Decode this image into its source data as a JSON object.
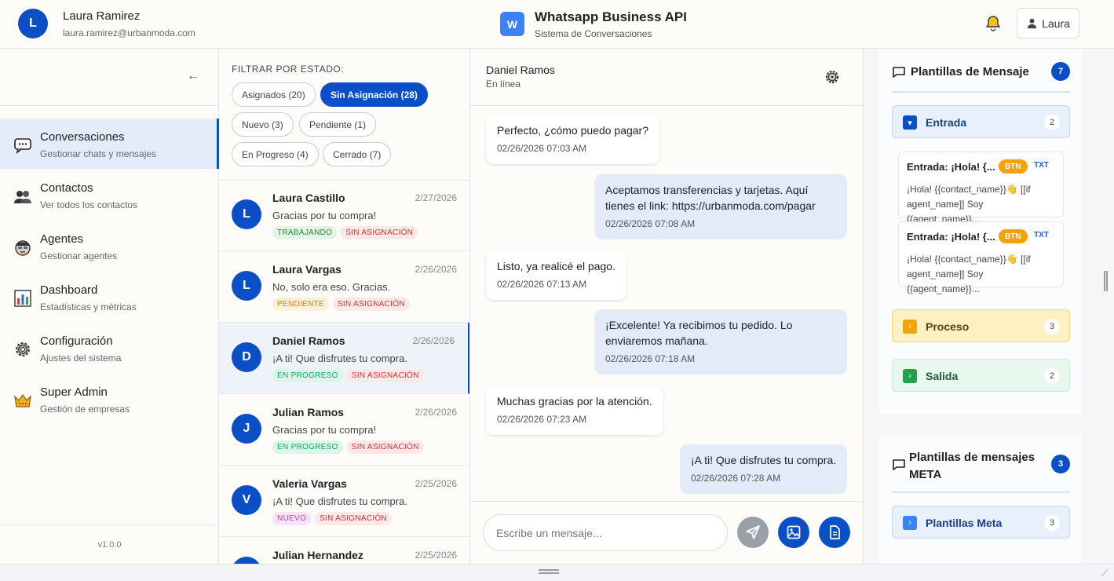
{
  "header": {
    "user_initial": "L",
    "user_name": "Laura Ramirez",
    "user_email": "laura.ramirez@urbanmoda.com",
    "brand_initial": "W",
    "brand_title": "Whatsapp Business API",
    "brand_subtitle": "Sistema de Conversaciones",
    "user_button_label": "Laura"
  },
  "nav": {
    "collapse_glyph": "←",
    "items": [
      {
        "title": "Conversaciones",
        "subtitle": "Gestionar chats y mensajes",
        "icon": "chat-icon"
      },
      {
        "title": "Contactos",
        "subtitle": "Ver todos los contactos",
        "icon": "contacts-icon"
      },
      {
        "title": "Agentes",
        "subtitle": "Gestionar agentes",
        "icon": "agent-icon"
      },
      {
        "title": "Dashboard",
        "subtitle": "Estadísticas y métricas",
        "icon": "chart-icon"
      },
      {
        "title": "Configuración",
        "subtitle": "Ajustes del sistema",
        "icon": "gear-icon"
      },
      {
        "title": "Super Admin",
        "subtitle": "Gestión de empresas",
        "icon": "crown-icon"
      }
    ],
    "version": "v1.0.0"
  },
  "filters": {
    "label": "FILTRAR POR ESTADO:",
    "chips": [
      "Asignados (20)",
      "Sin Asignación (28)",
      "Nuevo (3)",
      "Pendiente (1)",
      "En Progreso (4)",
      "Cerrado (7)"
    ]
  },
  "conversations": [
    {
      "initial": "L",
      "name": "Laura Castillo",
      "date": "2/27/2026",
      "message": "Gracias por tu compra!",
      "status": "TRABAJANDO",
      "assign": "SIN ASIGNACIÓN"
    },
    {
      "initial": "L",
      "name": "Laura Vargas",
      "date": "2/26/2026",
      "message": "No, solo era eso. Gracias.",
      "status": "PENDIENTE",
      "assign": "SIN ASIGNACIÓN"
    },
    {
      "initial": "D",
      "name": "Daniel Ramos",
      "date": "2/26/2026",
      "message": "¡A ti! Que disfrutes tu compra.",
      "status": "EN PROGRESO",
      "assign": "SIN ASIGNACIÓN"
    },
    {
      "initial": "J",
      "name": "Julian Ramos",
      "date": "2/26/2026",
      "message": "Gracias por tu compra!",
      "status": "EN PROGRESO",
      "assign": "SIN ASIGNACIÓN"
    },
    {
      "initial": "V",
      "name": "Valeria Vargas",
      "date": "2/25/2026",
      "message": "¡A ti! Que disfrutes tu compra.",
      "status": "NUEVO",
      "assign": "SIN ASIGNACIÓN"
    },
    {
      "initial": "J",
      "name": "Julian Hernandez",
      "date": "2/25/2026",
      "message": "",
      "status": "",
      "assign": ""
    }
  ],
  "chat": {
    "contact_name": "Daniel Ramos",
    "contact_status": "En línea",
    "messages": [
      {
        "text": "Perfecto, ¿cómo puedo pagar?",
        "time": "02/26/2026 07:03 AM",
        "dir": "in"
      },
      {
        "text": "Aceptamos transferencias y tarjetas. Aquí tienes el link: https://urbanmoda.com/pagar",
        "time": "02/26/2026 07:08 AM",
        "dir": "out"
      },
      {
        "text": "Listo, ya realicé el pago.",
        "time": "02/26/2026 07:13 AM",
        "dir": "in"
      },
      {
        "text": "¡Excelente! Ya recibimos tu pedido. Lo enviaremos mañana.",
        "time": "02/26/2026 07:18 AM",
        "dir": "out"
      },
      {
        "text": "Muchas gracias por la atención.",
        "time": "02/26/2026 07:23 AM",
        "dir": "in"
      },
      {
        "text": "¡A ti! Que disfrutes tu compra.",
        "time": "02/26/2026 07:28 AM",
        "dir": "out"
      }
    ],
    "input_placeholder": "Escribe un mensaje..."
  },
  "templates": {
    "title": "Plantillas de Mensaje",
    "count": "7",
    "categories": [
      {
        "label": "Entrada",
        "count": "2"
      },
      {
        "label": "Proceso",
        "count": "3"
      },
      {
        "label": "Salida",
        "count": "2"
      }
    ],
    "items": [
      {
        "title": "Entrada: ¡Hola! {...",
        "btn": "BTN",
        "txt": "TXT",
        "body": "¡Hola! {{contact_name}}👋 [[if agent_name]] Soy {{agent_name}}..."
      },
      {
        "title": "Entrada: ¡Hola! {...",
        "btn": "BTN",
        "txt": "TXT",
        "body": "¡Hola! {{contact_name}}👋 [[if agent_name]] Soy {{agent_name}}..."
      }
    ],
    "colors": {
      "entrada": "#0b4fc7",
      "proceso": "#f0a30a",
      "salida": "#22a04b"
    }
  },
  "meta_templates": {
    "title": "Plantillas de mensajes META",
    "count": "3",
    "category_label": "Plantillas Meta",
    "category_count": "3"
  },
  "colors": {
    "primary": "#0b4fc7",
    "active_bg": "#e4ecf9"
  }
}
